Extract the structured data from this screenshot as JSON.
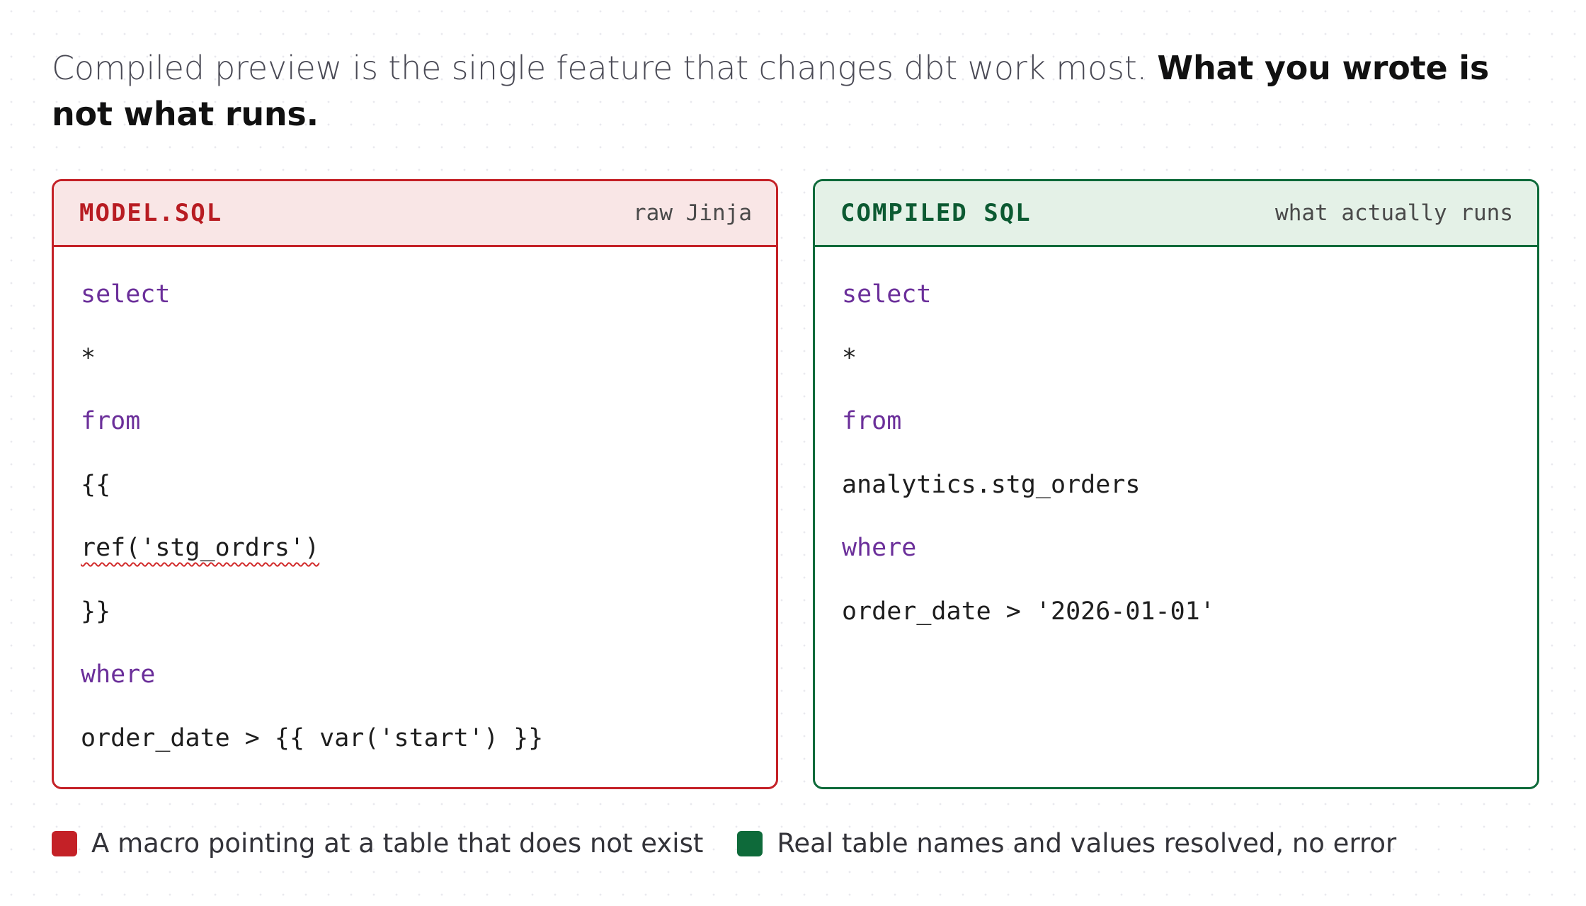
{
  "intro": {
    "lead": "Compiled preview is the single feature that changes dbt work most.",
    "emphasis": "What you wrote is not what runs."
  },
  "raw_panel": {
    "title": "MODEL.SQL",
    "subtitle": "raw Jinja",
    "lines": [
      {
        "text": "select",
        "kind": "keyword"
      },
      {
        "text": "*",
        "kind": "plain"
      },
      {
        "text": "from",
        "kind": "keyword"
      },
      {
        "text": "{{",
        "kind": "plain"
      },
      {
        "text": "ref('stg_ordrs')",
        "kind": "error"
      },
      {
        "text": "}}",
        "kind": "plain"
      },
      {
        "text": "where",
        "kind": "keyword"
      },
      {
        "text": "order_date > {{ var('start') }}",
        "kind": "plain"
      }
    ]
  },
  "compiled_panel": {
    "title": "COMPILED SQL",
    "subtitle": "what actually runs",
    "lines": [
      {
        "text": "select",
        "kind": "keyword"
      },
      {
        "text": "*",
        "kind": "plain"
      },
      {
        "text": "from",
        "kind": "keyword"
      },
      {
        "text": "analytics.stg_orders",
        "kind": "plain"
      },
      {
        "text": "where",
        "kind": "keyword"
      },
      {
        "text": "order_date > '2026-01-01'",
        "kind": "plain"
      }
    ]
  },
  "legend": [
    {
      "label": "A macro pointing at a table that does not exist",
      "color": "#c42127"
    },
    {
      "label": "Real table names and values resolved, no error",
      "color": "#0e6a3a"
    }
  ],
  "colors": {
    "error_accent": "#c42127",
    "success_accent": "#0e6a3a",
    "keyword": "#6b2f9a"
  }
}
